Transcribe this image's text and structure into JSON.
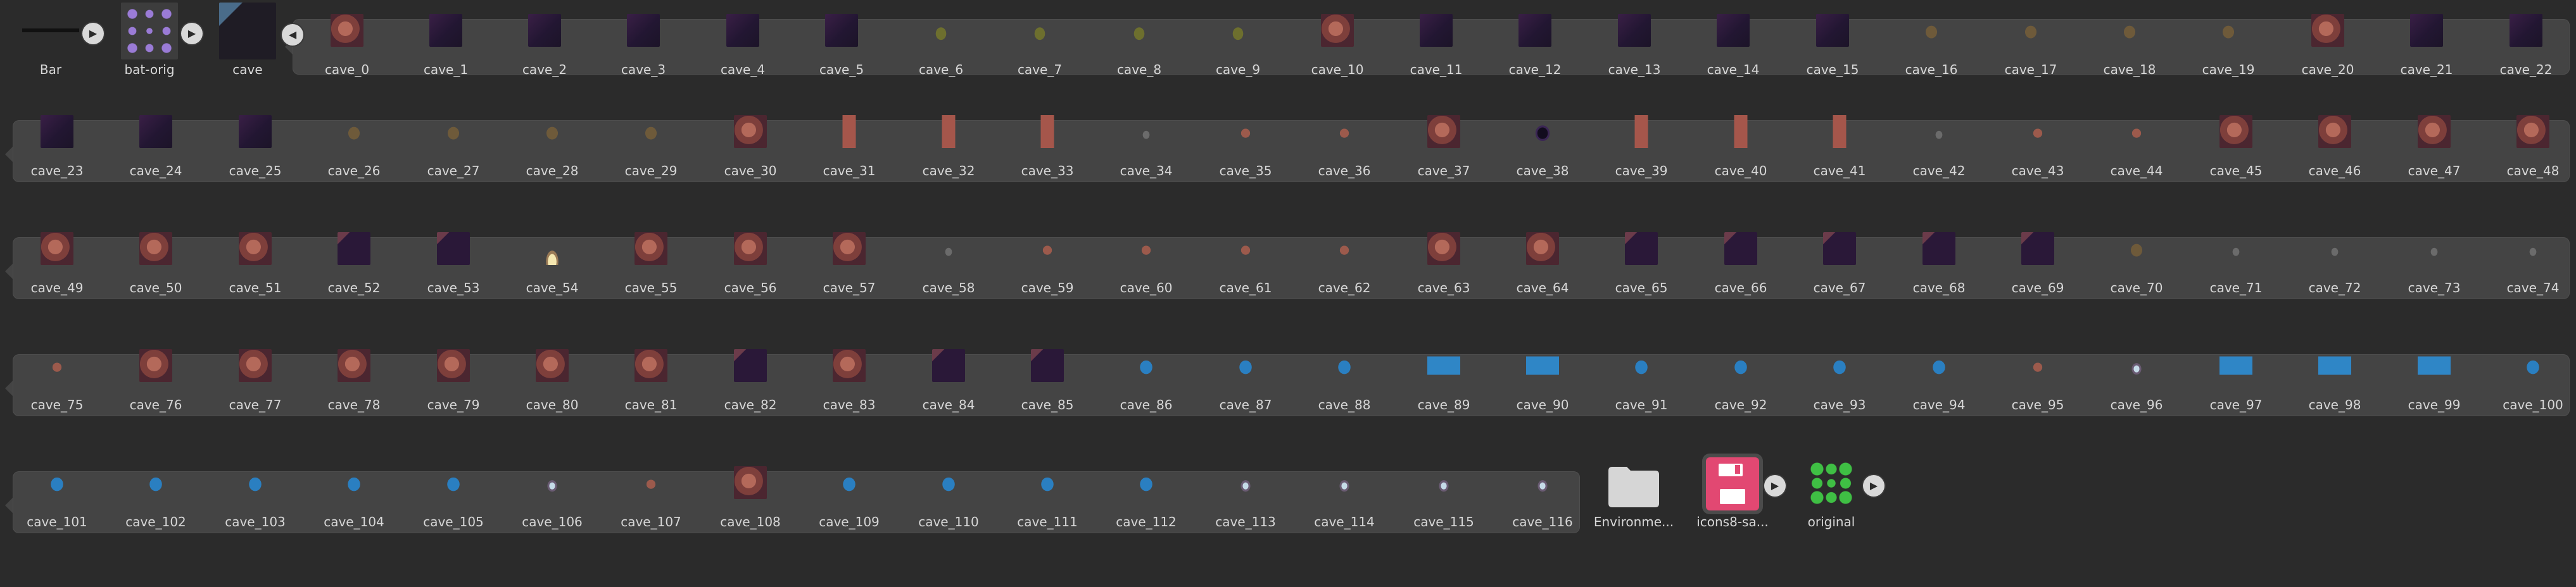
{
  "assets": [
    {
      "label": "Bar",
      "kind": "bar"
    },
    {
      "label": "bat-orig",
      "kind": "batorig"
    },
    {
      "label": "cave",
      "kind": "cave"
    },
    {
      "label": "cave_0",
      "kind": "rock"
    },
    {
      "label": "cave_1",
      "kind": "dark"
    },
    {
      "label": "cave_2",
      "kind": "dark"
    },
    {
      "label": "cave_3",
      "kind": "dark"
    },
    {
      "label": "cave_4",
      "kind": "dark"
    },
    {
      "label": "cave_5",
      "kind": "dark"
    },
    {
      "label": "cave_6",
      "kind": "grass"
    },
    {
      "label": "cave_7",
      "kind": "grass"
    },
    {
      "label": "cave_8",
      "kind": "grass"
    },
    {
      "label": "cave_9",
      "kind": "grass"
    },
    {
      "label": "cave_10",
      "kind": "rock"
    },
    {
      "label": "cave_11",
      "kind": "dark"
    },
    {
      "label": "cave_12",
      "kind": "dark"
    },
    {
      "label": "cave_13",
      "kind": "dark"
    },
    {
      "label": "cave_14",
      "kind": "dark"
    },
    {
      "label": "cave_15",
      "kind": "dark"
    },
    {
      "label": "cave_16",
      "kind": "plank"
    },
    {
      "label": "cave_17",
      "kind": "plank"
    },
    {
      "label": "cave_18",
      "kind": "plank"
    },
    {
      "label": "cave_19",
      "kind": "plank"
    },
    {
      "label": "cave_20",
      "kind": "rock"
    },
    {
      "label": "cave_21",
      "kind": "dark"
    },
    {
      "label": "cave_22",
      "kind": "dark"
    },
    {
      "label": "cave_23",
      "kind": "dark"
    },
    {
      "label": "cave_24",
      "kind": "dark"
    },
    {
      "label": "cave_25",
      "kind": "dark"
    },
    {
      "label": "cave_26",
      "kind": "plank"
    },
    {
      "label": "cave_27",
      "kind": "plank"
    },
    {
      "label": "cave_28",
      "kind": "plank"
    },
    {
      "label": "cave_29",
      "kind": "plank"
    },
    {
      "label": "cave_30",
      "kind": "rock"
    },
    {
      "label": "cave_31",
      "kind": "pillar"
    },
    {
      "label": "cave_32",
      "kind": "pillar"
    },
    {
      "label": "cave_33",
      "kind": "pillar"
    },
    {
      "label": "cave_34",
      "kind": "gray"
    },
    {
      "label": "cave_35",
      "kind": "small"
    },
    {
      "label": "cave_36",
      "kind": "small"
    },
    {
      "label": "cave_37",
      "kind": "rock"
    },
    {
      "label": "cave_38",
      "kind": "hole"
    },
    {
      "label": "cave_39",
      "kind": "pillar"
    },
    {
      "label": "cave_40",
      "kind": "pillar"
    },
    {
      "label": "cave_41",
      "kind": "pillar"
    },
    {
      "label": "cave_42",
      "kind": "gray"
    },
    {
      "label": "cave_43",
      "kind": "small"
    },
    {
      "label": "cave_44",
      "kind": "small"
    },
    {
      "label": "cave_45",
      "kind": "rock"
    },
    {
      "label": "cave_46",
      "kind": "rock"
    },
    {
      "label": "cave_47",
      "kind": "rock"
    },
    {
      "label": "cave_48",
      "kind": "rock"
    },
    {
      "label": "cave_49",
      "kind": "rock"
    },
    {
      "label": "cave_50",
      "kind": "rock"
    },
    {
      "label": "cave_51",
      "kind": "rock"
    },
    {
      "label": "cave_52",
      "kind": "darkedge"
    },
    {
      "label": "cave_53",
      "kind": "darkedge"
    },
    {
      "label": "cave_54",
      "kind": "light"
    },
    {
      "label": "cave_55",
      "kind": "rock"
    },
    {
      "label": "cave_56",
      "kind": "rock"
    },
    {
      "label": "cave_57",
      "kind": "rock"
    },
    {
      "label": "cave_58",
      "kind": "gray"
    },
    {
      "label": "cave_59",
      "kind": "small"
    },
    {
      "label": "cave_60",
      "kind": "small"
    },
    {
      "label": "cave_61",
      "kind": "small"
    },
    {
      "label": "cave_62",
      "kind": "small"
    },
    {
      "label": "cave_63",
      "kind": "rock"
    },
    {
      "label": "cave_64",
      "kind": "rock"
    },
    {
      "label": "cave_65",
      "kind": "darkedge"
    },
    {
      "label": "cave_66",
      "kind": "darkedge"
    },
    {
      "label": "cave_67",
      "kind": "darkedge"
    },
    {
      "label": "cave_68",
      "kind": "darkedge"
    },
    {
      "label": "cave_69",
      "kind": "darkedge"
    },
    {
      "label": "cave_70",
      "kind": "plank"
    },
    {
      "label": "cave_71",
      "kind": "gray"
    },
    {
      "label": "cave_72",
      "kind": "gray"
    },
    {
      "label": "cave_73",
      "kind": "gray"
    },
    {
      "label": "cave_74",
      "kind": "gray"
    },
    {
      "label": "cave_75",
      "kind": "small"
    },
    {
      "label": "cave_76",
      "kind": "rock"
    },
    {
      "label": "cave_77",
      "kind": "rock"
    },
    {
      "label": "cave_78",
      "kind": "rock"
    },
    {
      "label": "cave_79",
      "kind": "rock"
    },
    {
      "label": "cave_80",
      "kind": "rock"
    },
    {
      "label": "cave_81",
      "kind": "rock"
    },
    {
      "label": "cave_82",
      "kind": "darkedge"
    },
    {
      "label": "cave_83",
      "kind": "rock"
    },
    {
      "label": "cave_84",
      "kind": "darkedge"
    },
    {
      "label": "cave_85",
      "kind": "darkedge"
    },
    {
      "label": "cave_86",
      "kind": "water"
    },
    {
      "label": "cave_87",
      "kind": "water"
    },
    {
      "label": "cave_88",
      "kind": "water"
    },
    {
      "label": "cave_89",
      "kind": "waterb"
    },
    {
      "label": "cave_90",
      "kind": "waterb"
    },
    {
      "label": "cave_91",
      "kind": "water"
    },
    {
      "label": "cave_92",
      "kind": "water"
    },
    {
      "label": "cave_93",
      "kind": "water"
    },
    {
      "label": "cave_94",
      "kind": "water"
    },
    {
      "label": "cave_95",
      "kind": "small"
    },
    {
      "label": "cave_96",
      "kind": "boat"
    },
    {
      "label": "cave_97",
      "kind": "waterb"
    },
    {
      "label": "cave_98",
      "kind": "waterb"
    },
    {
      "label": "cave_99",
      "kind": "waterb"
    },
    {
      "label": "cave_100",
      "kind": "water"
    },
    {
      "label": "cave_101",
      "kind": "water"
    },
    {
      "label": "cave_102",
      "kind": "water"
    },
    {
      "label": "cave_103",
      "kind": "water"
    },
    {
      "label": "cave_104",
      "kind": "water"
    },
    {
      "label": "cave_105",
      "kind": "water"
    },
    {
      "label": "cave_106",
      "kind": "boat"
    },
    {
      "label": "cave_107",
      "kind": "small"
    },
    {
      "label": "cave_108",
      "kind": "rock"
    },
    {
      "label": "cave_109",
      "kind": "water"
    },
    {
      "label": "cave_110",
      "kind": "water"
    },
    {
      "label": "cave_111",
      "kind": "water"
    },
    {
      "label": "cave_112",
      "kind": "water"
    },
    {
      "label": "cave_113",
      "kind": "boat"
    },
    {
      "label": "cave_114",
      "kind": "boat"
    },
    {
      "label": "cave_115",
      "kind": "boat"
    },
    {
      "label": "cave_116",
      "kind": "boat"
    },
    {
      "label": "Environme...",
      "kind": "folder"
    },
    {
      "label": "icons8-sa...",
      "kind": "floppy"
    },
    {
      "label": "original",
      "kind": "original"
    }
  ],
  "icons": {
    "play": "▶",
    "back": "◀"
  },
  "colors": {
    "background": "#2b2b2b",
    "panel": "#444444",
    "label": "#d7d7d7"
  }
}
